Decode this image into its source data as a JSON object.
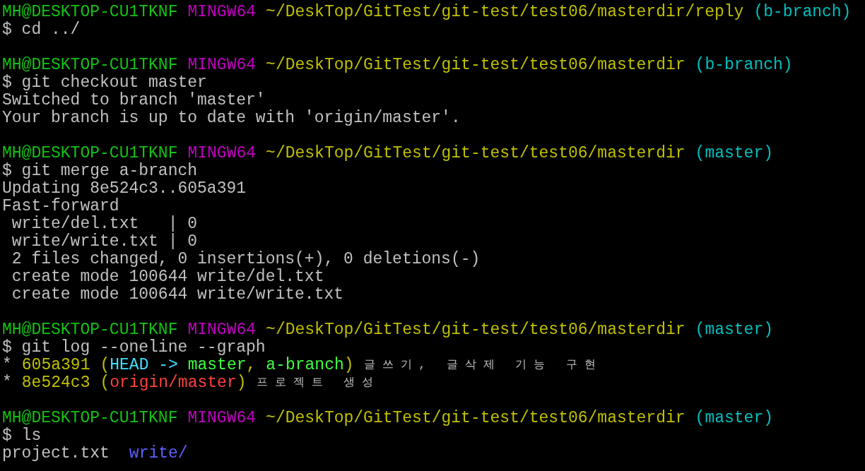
{
  "blocks": [
    {
      "prompt": {
        "user": "MH@DESKTOP-CU1TKNF",
        "system": "MINGW64",
        "path": "~/DeskTop/GitTest/git-test/test06/masterdir/reply",
        "branch": "(b-branch)"
      },
      "command": "$ cd ../"
    },
    {
      "prompt": {
        "user": "MH@DESKTOP-CU1TKNF",
        "system": "MINGW64",
        "path": "~/DeskTop/GitTest/git-test/test06/masterdir",
        "branch": "(b-branch)"
      },
      "command": "$ git checkout master",
      "output": [
        {
          "segments": [
            {
              "text": "Switched to branch 'master'",
              "color": "#c0c0c0",
              "kind": "text"
            }
          ]
        },
        {
          "segments": [
            {
              "text": "Your branch is up to date with 'origin/master'.",
              "color": "#c0c0c0",
              "kind": "text"
            }
          ]
        }
      ]
    },
    {
      "prompt": {
        "user": "MH@DESKTOP-CU1TKNF",
        "system": "MINGW64",
        "path": "~/DeskTop/GitTest/git-test/test06/masterdir",
        "branch": "(master)"
      },
      "command": "$ git merge a-branch",
      "output": [
        {
          "segments": [
            {
              "text": "Updating 8e524c3..605a391",
              "color": "#c0c0c0",
              "kind": "text"
            }
          ]
        },
        {
          "segments": [
            {
              "text": "Fast-forward",
              "color": "#c0c0c0",
              "kind": "text"
            }
          ]
        },
        {
          "segments": [
            {
              "text": " write/del.txt   | 0",
              "color": "#c0c0c0",
              "kind": "text"
            }
          ]
        },
        {
          "segments": [
            {
              "text": " write/write.txt | 0",
              "color": "#c0c0c0",
              "kind": "text"
            }
          ]
        },
        {
          "segments": [
            {
              "text": " 2 files changed, 0 insertions(+), 0 deletions(-)",
              "color": "#c0c0c0",
              "kind": "text"
            }
          ]
        },
        {
          "segments": [
            {
              "text": " create mode 100644 write/del.txt",
              "color": "#c0c0c0",
              "kind": "text"
            }
          ]
        },
        {
          "segments": [
            {
              "text": " create mode 100644 write/write.txt",
              "color": "#c0c0c0",
              "kind": "text"
            }
          ]
        }
      ]
    },
    {
      "prompt": {
        "user": "MH@DESKTOP-CU1TKNF",
        "system": "MINGW64",
        "path": "~/DeskTop/GitTest/git-test/test06/masterdir",
        "branch": "(master)"
      },
      "command": "$ git log --oneline --graph",
      "output": [
        {
          "segments": [
            {
              "text": "*",
              "color": "#c0c0c0",
              "kind": "text"
            },
            {
              "text": "605a391",
              "color": "#c0c000",
              "kind": "text"
            },
            {
              "text": "(",
              "color": "#c0c000",
              "kind": "text"
            },
            {
              "text": "HEAD -> ",
              "color": "#40e0ff",
              "kind": "text"
            },
            {
              "text": "master",
              "color": "#40ff40",
              "kind": "text"
            },
            {
              "text": ",",
              "color": "#c0c000",
              "kind": "text"
            },
            {
              "text": "a-branch",
              "color": "#40ff40",
              "kind": "text"
            },
            {
              "text": ")",
              "color": "#c0c000",
              "kind": "text"
            },
            {
              "text": "글쓰기, 글삭제 기능 구현",
              "color": "#c0c0c0",
              "kind": "wide"
            }
          ]
        },
        {
          "segments": [
            {
              "text": "*",
              "color": "#c0c0c0",
              "kind": "text"
            },
            {
              "text": "8e524c3",
              "color": "#c0c000",
              "kind": "text"
            },
            {
              "text": "(",
              "color": "#c0c000",
              "kind": "text"
            },
            {
              "text": "origin/master",
              "color": "#ff4040",
              "kind": "text"
            },
            {
              "text": ")",
              "color": "#c0c000",
              "kind": "text"
            },
            {
              "text": "프로젝트 생성",
              "color": "#c0c0c0",
              "kind": "wide"
            }
          ]
        }
      ]
    },
    {
      "prompt": {
        "user": "MH@DESKTOP-CU1TKNF",
        "system": "MINGW64",
        "path": "~/DeskTop/GitTest/git-test/test06/masterdir",
        "branch": "(master)"
      },
      "command": "$ ls",
      "output": [
        {
          "segments": [
            {
              "text": "project.txt",
              "color": "#c0c0c0",
              "kind": "text"
            },
            {
              "text": "write/",
              "color": "#6060ff",
              "kind": "text"
            }
          ]
        }
      ]
    }
  ]
}
